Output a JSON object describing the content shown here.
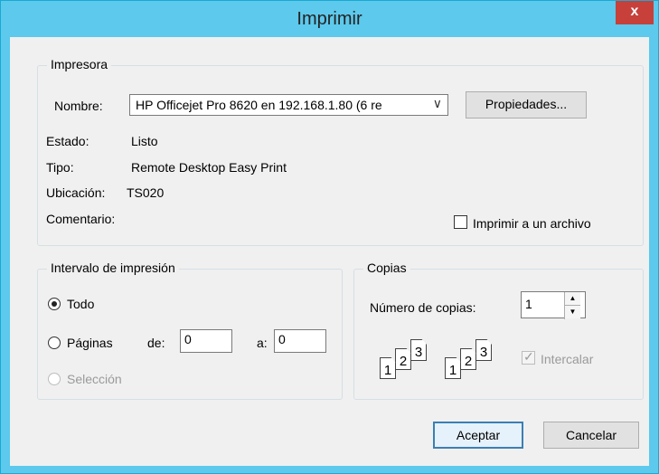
{
  "window": {
    "title": "Imprimir",
    "close_label": "x"
  },
  "printer": {
    "legend": "Impresora",
    "name_label": "Nombre:",
    "name_value": "HP Officejet Pro 8620 en 192.168.1.80 (6 re",
    "properties_label": "Propiedades...",
    "status_label": "Estado:",
    "status_value": "Listo",
    "type_label": "Tipo:",
    "type_value": "Remote Desktop Easy Print",
    "location_label": "Ubicación:",
    "location_value": "TS020",
    "comment_label": "Comentario:",
    "print_to_file_label": "Imprimir a un archivo"
  },
  "range": {
    "legend": "Intervalo de impresión",
    "all_label": "Todo",
    "pages_label": "Páginas",
    "from_label": "de:",
    "from_value": "0",
    "to_label": "a:",
    "to_value": "0",
    "selection_label": "Selección"
  },
  "copies": {
    "legend": "Copias",
    "count_label": "Número de copias:",
    "count_value": "1",
    "collate_label": "Intercalar",
    "page_numbers": [
      "1",
      "2",
      "3"
    ]
  },
  "buttons": {
    "accept_label": "Aceptar",
    "cancel_label": "Cancelar"
  }
}
